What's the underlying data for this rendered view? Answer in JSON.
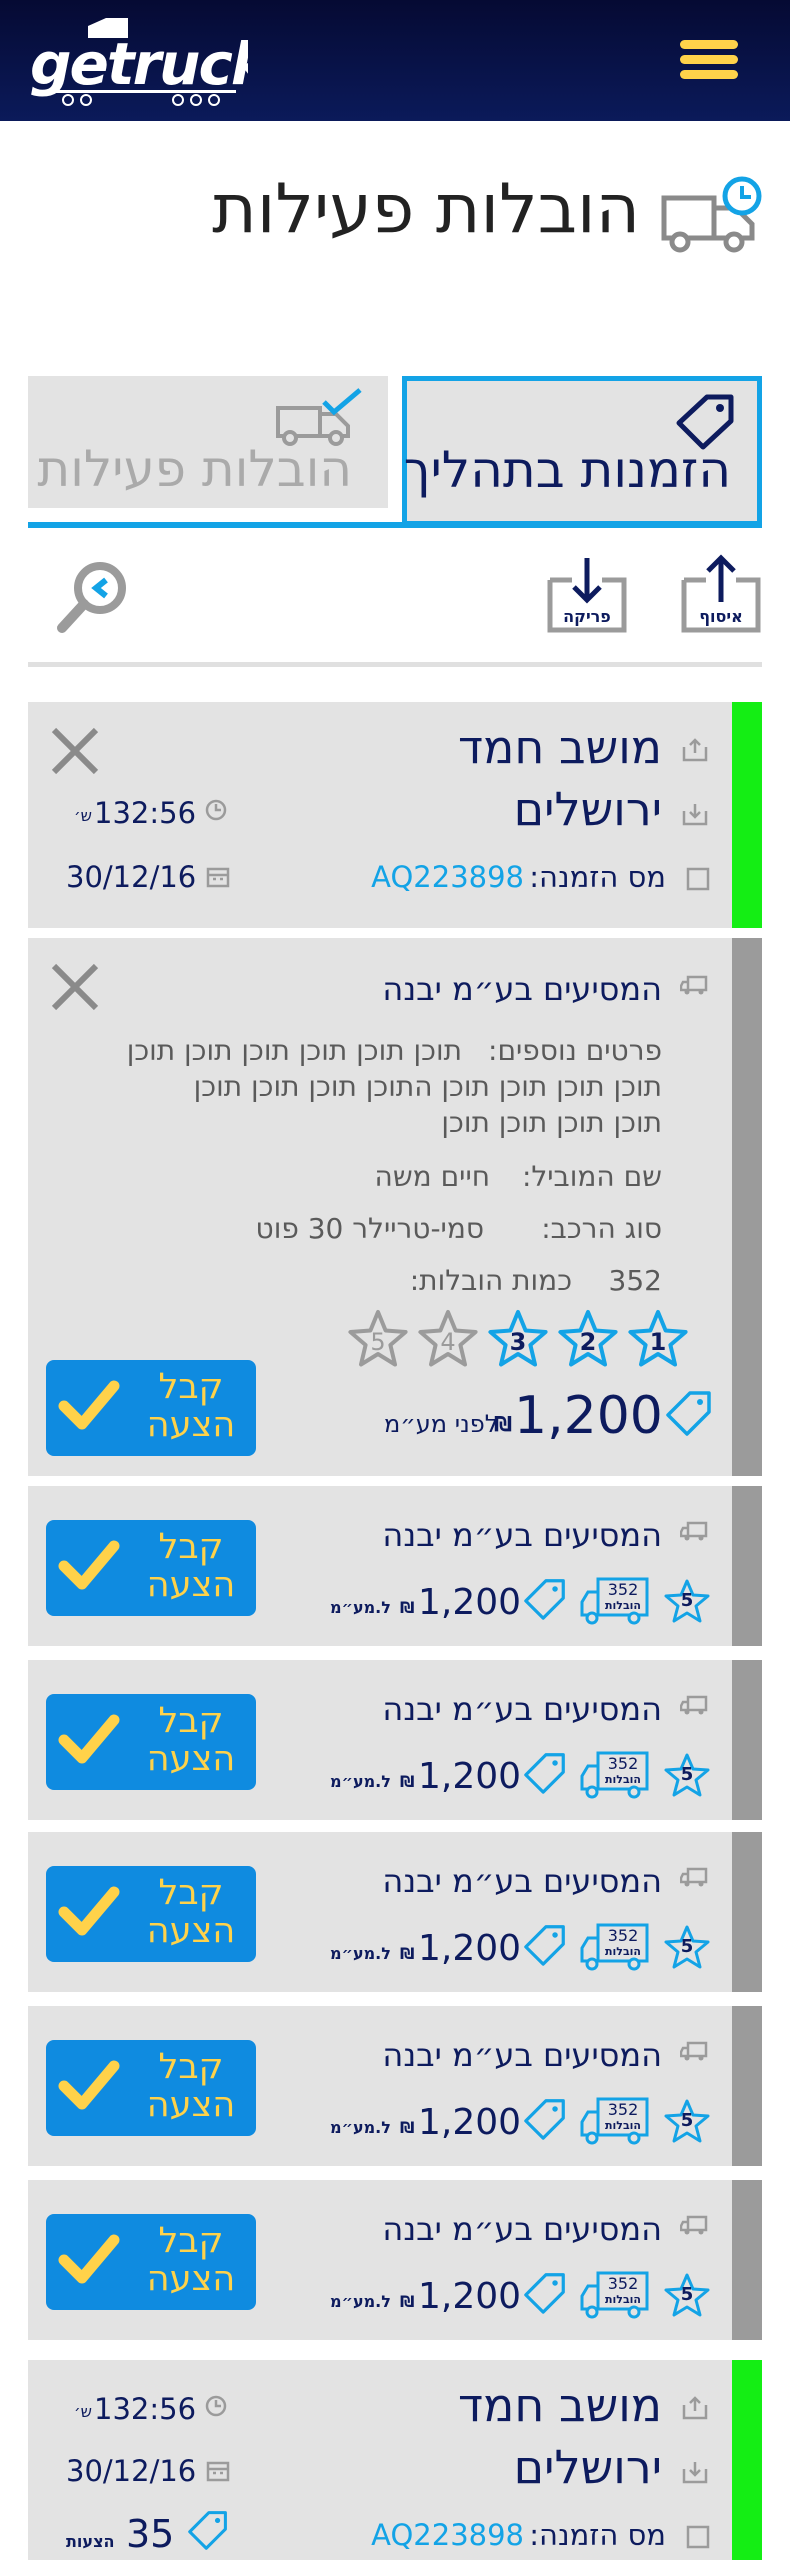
{
  "app": {
    "logo_text": "GETRUCK",
    "menu_icon": "hamburger-menu-icon"
  },
  "page": {
    "title": "הובלות פעילות"
  },
  "tabs": [
    {
      "label": "הזמנות בתהליך",
      "active": true,
      "icon": "tag-icon"
    },
    {
      "label": "הובלות פעילות",
      "active": false,
      "icon": "truck-check-icon"
    }
  ],
  "toolbar": {
    "pickup_label": "איסוף",
    "unload_label": "פריקה",
    "filter_icon": "location-search-icon"
  },
  "order_cards": [
    {
      "origin": "מושב חמד",
      "destination": "ירושלים",
      "time": "132:56",
      "time_unit": "ש׳",
      "date": "30/12/16",
      "order_label": "מס הזמנה:",
      "order_number": "AQ223898",
      "status_color": "#14ee14"
    },
    {
      "origin": "מושב חמד",
      "destination": "ירושלים",
      "time": "132:56",
      "time_unit": "ש׳",
      "date": "30/12/16",
      "order_label": "מס הזמנה:",
      "order_number": "AQ223898",
      "offers_count": "35",
      "offers_label": "הצעות",
      "status_color": "#14ee14"
    }
  ],
  "expanded_offer": {
    "company": "המסיעים בע״מ יבנה",
    "details_label": "פרטים נוספים:",
    "details_line1": "תוכן תוכן תוכן תוכן תוכן תוכן",
    "details_line2": "תוכן תוכן תוכן תוכן התוכן תוכן תוכן תוכן",
    "details_line3": "תוכן תוכן תוכן תוכן",
    "mover_label": "שם המוביל:",
    "mover_name": "חיים משה",
    "vehicle_label": "סוג הרכב:",
    "vehicle_type": "סמי-טריילר 30 פוט",
    "deliveries_label": "כמות הובלות:",
    "deliveries_count": "352",
    "rating": 3,
    "rating_max": 5,
    "star_labels": [
      "1",
      "2",
      "3",
      "4",
      "5"
    ],
    "price": "1,200",
    "currency": "₪",
    "price_note": "לפני מע״מ",
    "accept_label": "קבל הצעה",
    "status_color": "#9b9b9b"
  },
  "offers": [
    {
      "company": "המסיעים בע״מ יבנה",
      "rating": "5",
      "deliveries": "352",
      "deliveries_label": "הובלות",
      "price": "1,200",
      "currency": "₪",
      "vat_note": "ל.מע״מ",
      "accept_label": "קבל הצעה"
    },
    {
      "company": "המסיעים בע״מ יבנה",
      "rating": "5",
      "deliveries": "352",
      "deliveries_label": "הובלות",
      "price": "1,200",
      "currency": "₪",
      "vat_note": "ל.מע״מ",
      "accept_label": "קבל הצעה"
    },
    {
      "company": "המסיעים בע״מ יבנה",
      "rating": "5",
      "deliveries": "352",
      "deliveries_label": "הובלות",
      "price": "1,200",
      "currency": "₪",
      "vat_note": "ל.מע״מ",
      "accept_label": "קבל הצעה"
    },
    {
      "company": "המסיעים בע״מ יבנה",
      "rating": "5",
      "deliveries": "352",
      "deliveries_label": "הובלות",
      "price": "1,200",
      "currency": "₪",
      "vat_note": "ל.מע״מ",
      "accept_label": "קבל הצעה"
    },
    {
      "company": "המסיעים בע״מ יבנה",
      "rating": "5",
      "deliveries": "352",
      "deliveries_label": "הובלות",
      "price": "1,200",
      "currency": "₪",
      "vat_note": "ל.מע״מ",
      "accept_label": "קבל הצעה"
    }
  ],
  "colors": {
    "header_bg": "#0b1a5a",
    "accent_blue": "#13a3e6",
    "button_blue": "#0f8be0",
    "button_text_yellow": "#ffd24a",
    "text_navy": "#0d1b5e",
    "card_bg": "#e3e3e3",
    "status_green": "#14ee14",
    "status_gray": "#9b9b9b"
  }
}
